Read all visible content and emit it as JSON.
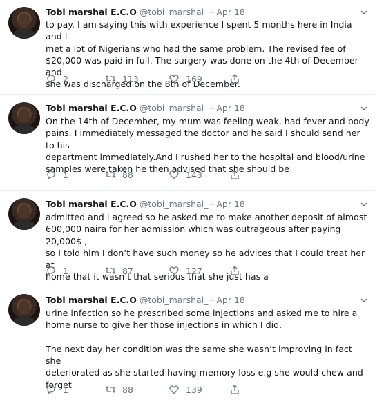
{
  "tweets": [
    {
      "name": "Tobi marshal E.C.O",
      "handle": "@tobi_marshal_",
      "dot": "·",
      "date": "Apr 18",
      "text": "to pay. I am saying this with experience I spent 5 months here in India and I\nmet a lot of Nigerians who had the same problem. The revised fee of\n$20,000 was paid in full. The surgery was done on the 4th of December and\nshe was discharged on the 8th of December.",
      "replies": "2",
      "retweets": "113",
      "likes": "169"
    },
    {
      "name": "Tobi marshal E.C.O",
      "handle": "@tobi_marshal_",
      "dot": "·",
      "date": "Apr 18",
      "text": "On the 14th of December, my mum was feeling weak, had fever and body\npains. I immediately messaged the doctor and he said I should send her to his\ndepartment immediately.And I rushed her to the hospital and blood/urine\nsamples were taken he then advised that she should be",
      "replies": "1",
      "retweets": "88",
      "likes": "143"
    },
    {
      "name": "Tobi marshal E.C.O",
      "handle": "@tobi_marshal_",
      "dot": "·",
      "date": "Apr 18",
      "text": "admitted and I agreed so he asked me to make another deposit of almost\n600,000 naira for her admission which was outrageous after paying 20,000$ ,\nso I told him I don’t have such money so he advices that I could treat her at\nhome that it wasn’t that serious that she just has a",
      "replies": "1",
      "retweets": "87",
      "likes": "127"
    },
    {
      "name": "Tobi marshal E.C.O",
      "handle": "@tobi_marshal_",
      "dot": "·",
      "date": "Apr 18",
      "text": "urine infection so he prescribed some injections and asked me to hire a\nhome nurse to give her those injections in which I did.\n\nThe next day her condition was the same she wasn’t improving in fact she\ndeteriorated as she started having memory loss e.g she would chew and\nforget",
      "replies": "1",
      "retweets": "88",
      "likes": "139"
    }
  ],
  "colors": {
    "text": "#14171a",
    "muted": "#657786",
    "divider": "#e6ecf0"
  },
  "icons": {
    "reply": "reply-icon",
    "retweet": "retweet-icon",
    "like": "heart-icon",
    "share": "share-icon",
    "caret": "chevron-down-icon"
  }
}
